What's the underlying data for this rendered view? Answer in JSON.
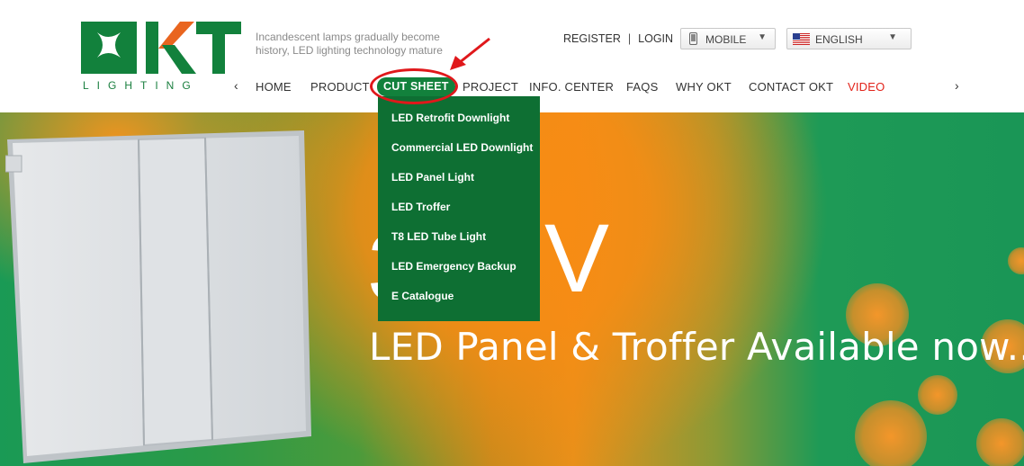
{
  "header": {
    "logo_text": "OKT",
    "logo_subtitle": "LIGHTING",
    "slogan": "Incandescent lamps gradually become history, LED lighting technology mature",
    "register_label": "REGISTER",
    "separator": "|",
    "login_label": "LOGIN",
    "mobile_label": "MOBILE",
    "language_label": "ENGLISH"
  },
  "nav": {
    "prev_arrow": "‹",
    "next_arrow": "›",
    "items": [
      {
        "label": "HOME"
      },
      {
        "label": "PRODUCT"
      },
      {
        "label": "CUT SHEET"
      },
      {
        "label": "PROJECT"
      },
      {
        "label": "INFO. CENTER"
      },
      {
        "label": "FAQS"
      },
      {
        "label": "WHY OKT"
      },
      {
        "label": "CONTACT OKT"
      },
      {
        "label": "VIDEO"
      }
    ]
  },
  "dropdown": {
    "items": [
      {
        "label": "LED Retrofit Downlight"
      },
      {
        "label": "Commercial LED Downlight"
      },
      {
        "label": "LED Panel Light"
      },
      {
        "label": "LED Troffer"
      },
      {
        "label": "T8 LED Tube Light"
      },
      {
        "label": "LED Emergency Backup"
      },
      {
        "label": "E Catalogue"
      }
    ]
  },
  "banner": {
    "big_text_left": "3",
    "big_text_right": "V",
    "headline": "LED Panel & Troffer Available now..."
  },
  "colors": {
    "brand_green": "#12813c",
    "dropdown_green": "#0e6f33",
    "video_red": "#e2231a",
    "annotation_red": "#e0181b"
  },
  "icons": {
    "mobile": "mobile-phone-icon",
    "language_flag": "us-flag-icon",
    "dropdown": "triangle-down-icon"
  }
}
